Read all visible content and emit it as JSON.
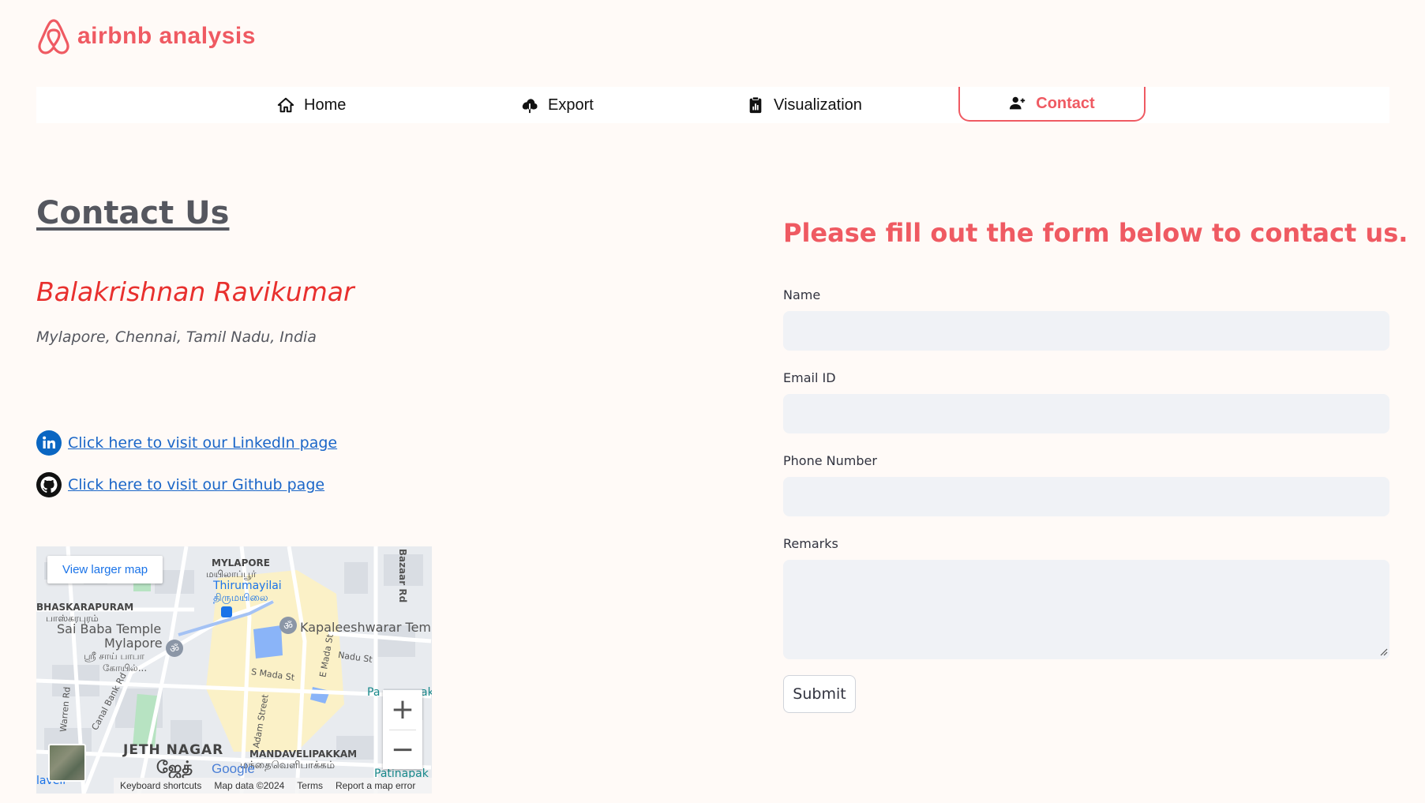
{
  "app": {
    "logo_text": "airbnb analysis",
    "brand_color": "#ef5a62"
  },
  "nav": {
    "items": [
      {
        "label": "Home",
        "icon": "house-icon"
      },
      {
        "label": "Export",
        "icon": "cloud-download-icon"
      },
      {
        "label": "Visualization",
        "icon": "clipboard-chart-icon"
      },
      {
        "label": "Contact",
        "icon": "person-add-icon",
        "active": true
      }
    ]
  },
  "contact": {
    "title": "Contact Us",
    "name": "Balakrishnan Ravikumar",
    "address": "Mylapore, Chennai, Tamil Nadu, India",
    "linkedin_text": "Click here to visit our LinkedIn page",
    "github_text": "Click here to visit our Github page"
  },
  "map": {
    "larger_map": "View larger map",
    "zoom_in": "+",
    "zoom_out": "−",
    "footer": {
      "shortcuts": "Keyboard shortcuts",
      "data": "Map data ©2024",
      "terms": "Terms",
      "report": "Report a map error"
    },
    "labels": {
      "mylapore_area": "MYLAPORE",
      "mylapore_tamil": "மயிலாப்பூர்",
      "thirumayilai": "Thirumayilai",
      "thirumayilai_tamil": "திருமயிலை",
      "bhaskarapuram": "BHASKARAPURAM",
      "bhaskarapuram_tamil": "பாஸ்கரபுரம்",
      "sai_baba": "Sai Baba Temple",
      "sai_baba_2": "Mylapore",
      "sai_baba_tamil": "ஸ்ரீ சாய் பாபா",
      "sai_baba_tamil2": "கோயில்...",
      "kapaleeshwarar": "Kapaleeshwarar Temp",
      "nadu_st": "Nadu St",
      "s_mada_st": "S Mada St",
      "e_mada_st": "E Mada St",
      "adam_street": "Adam Street",
      "canal_bank": "Canal Bank Rd",
      "warren_rd": "Warren Rd",
      "bazaar_rd": "Bazaar Rd",
      "jeth_nagar": "JETH NAGAR",
      "jeth_tamil": "ஜேத்",
      "mandavelipakkam": "MANDAVELIPAKKAM",
      "mandaveli_tamil": "மந்தைவெளிபாக்கம்",
      "patinapak": "Patinapak",
      "pattinapak_top": "Pa",
      "pattinapak_top2": "ak",
      "google": "Google",
      "javeli": "laveli"
    }
  },
  "form": {
    "heading": "Please fill out the form below to contact us.",
    "name_label": "Name",
    "email_label": "Email ID",
    "phone_label": "Phone Number",
    "remarks_label": "Remarks",
    "name_value": "",
    "email_value": "",
    "phone_value": "",
    "remarks_value": "",
    "submit_label": "Submit"
  }
}
